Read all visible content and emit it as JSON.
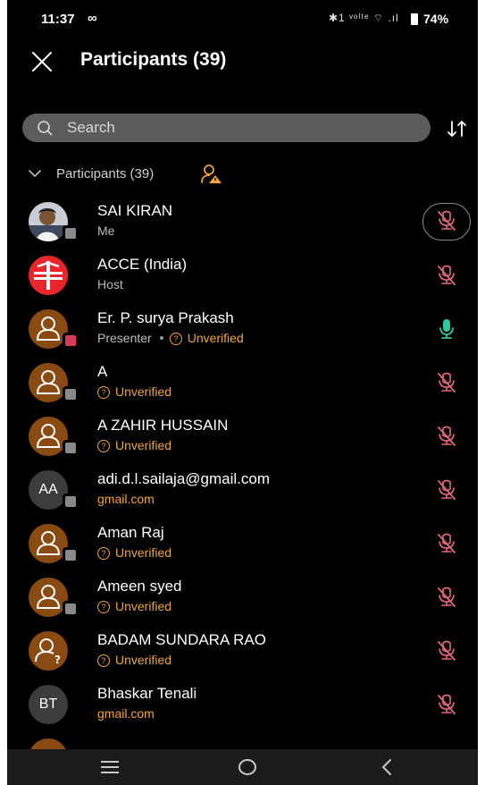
{
  "status_bar": {
    "time": "11:37",
    "infinity_glyph": "∞",
    "signal_text": "✱1 ᵛᵒˡᵗᵉ ⌔ .ıl",
    "battery": "74%"
  },
  "header": {
    "title": "Participants (39)",
    "close_icon": "close-icon"
  },
  "search": {
    "placeholder": "Search",
    "sort_icon": "sort-icon"
  },
  "section": {
    "label": "Participants (39)",
    "warning_icon": "person-warning-icon"
  },
  "colors": {
    "background": "#000000",
    "search_bg": "#5c5c5c",
    "unverified": "#f0a33c",
    "muted_mic": "#e56a7a",
    "active_mic": "#2fc7a0",
    "host_red": "#e8262c"
  },
  "participants": [
    {
      "name": "SAI KIRAN",
      "subtitle": "Me",
      "avatar": "photo",
      "mic": "muted"
    },
    {
      "name": "ACCE (India)",
      "subtitle": "Host",
      "avatar": "logo",
      "mic": "muted"
    },
    {
      "name": "Er. P. surya Prakash",
      "subtitle": "Presenter",
      "status": "Unverified",
      "avatar": "person",
      "mic": "active"
    },
    {
      "name": "A",
      "status": "Unverified",
      "avatar": "person",
      "mic": "muted"
    },
    {
      "name": "A ZAHIR HUSSAIN",
      "status": "Unverified",
      "avatar": "person",
      "mic": "muted"
    },
    {
      "name": "adi.d.l.sailaja@gmail.com",
      "domain": "gmail.com",
      "initials": "AA",
      "avatar": "initials",
      "mic": "muted"
    },
    {
      "name": "Aman Raj",
      "status": "Unverified",
      "avatar": "person",
      "mic": "muted"
    },
    {
      "name": "Ameen syed",
      "status": "Unverified",
      "avatar": "person",
      "mic": "muted"
    },
    {
      "name": "BADAM SUNDARA RAO",
      "status": "Unverified",
      "avatar": "person-question",
      "mic": "muted"
    },
    {
      "name": "Bhaskar Tenali",
      "domain": "gmail.com",
      "initials": "BT",
      "avatar": "initials",
      "mic": "muted"
    }
  ],
  "nav": {
    "recents_icon": "menu-icon",
    "home_icon": "home-icon",
    "back_icon": "back-icon"
  }
}
